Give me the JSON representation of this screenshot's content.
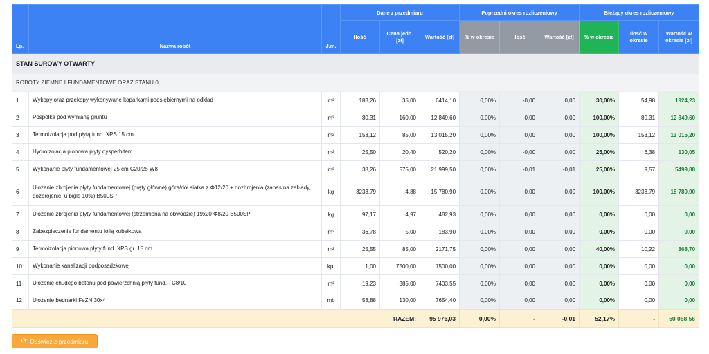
{
  "header": {
    "lp": "Lp.",
    "name": "Nazwa robót",
    "jm": "J.m.",
    "group_przedmiar": "Dane z przedmiaru",
    "group_poprzedni": "Poprzedni okres rozliczeniowy",
    "group_biezacy": "Bieżący okres rozliczeniowy",
    "ilosc": "Ilość",
    "cena": "Cena jedn. [zł]",
    "wartosc": "Wartość [zł]",
    "proc_w_okresie": "% w okresie",
    "ilosc2": "Ilość",
    "wartosc2": "Wartość [zł]",
    "proc_w_okresie3": "% w okresie",
    "ilosc_w_okresie": "Ilość w okresie",
    "wartosc_w_okresie": "Wartość w okresie [zł]"
  },
  "section": "STAN SUROWY OTWARTY",
  "subsection": "ROBOTY ZIEMNE I FUNDAMENTOWE ORAZ STANU 0",
  "rows": [
    {
      "lp": "1",
      "name": "Wykopy oraz przekopy wykonywane koparkami podsiębiernymi na odkład",
      "jm": "m³",
      "ilosc": "183,26",
      "cena": "35,00",
      "wartosc": "6414,10",
      "pp": "0,00%",
      "pi": "-0,00",
      "pw": "0,00",
      "bp": "30,00%",
      "bi": "54,98",
      "bw": "1924,23"
    },
    {
      "lp": "2",
      "name": "Pospółka pod wymianę gruntu",
      "jm": "m³",
      "ilosc": "80,31",
      "cena": "160,00",
      "wartosc": "12 849,60",
      "pp": "0,00%",
      "pi": "0,00",
      "pw": "0,00",
      "bp": "100,00%",
      "bi": "80,31",
      "bw": "12 849,60"
    },
    {
      "lp": "3",
      "name": "Termoizolacja pod płytą fund. XPS 15 cm",
      "jm": "m²",
      "ilosc": "153,12",
      "cena": "85,00",
      "wartosc": "13 015,20",
      "pp": "0,00%",
      "pi": "0,00",
      "pw": "0,00",
      "bp": "100,00%",
      "bi": "153,12",
      "bw": "13 015,20"
    },
    {
      "lp": "4",
      "name": "Hydroizolacja pionowa płyty dysperbitem",
      "jm": "m²",
      "ilosc": "25,50",
      "cena": "20,40",
      "wartosc": "520,20",
      "pp": "0,00%",
      "pi": "-0,00",
      "pw": "0,00",
      "bp": "25,00%",
      "bi": "6,38",
      "bw": "130,05"
    },
    {
      "lp": "5",
      "name": "Wykonanie płyty fundamentowej 25 cm C20/25 W8",
      "jm": "m³",
      "ilosc": "38,26",
      "cena": "575,00",
      "wartosc": "21 999,50",
      "pp": "0,00%",
      "pi": "-0,01",
      "pw": "-0,01",
      "bp": "25,00%",
      "bi": "9,57",
      "bw": "5499,88"
    },
    {
      "lp": "6",
      "name": "Ułożenie zbrojenia płyty fundamentowej (pręty główne) góra/dół siatka z Φ12/20 + dozbrojenia (zapas na zakłady, dozbrojenie, u bigle 10%) B500SP",
      "jm": "kg",
      "ilosc": "3233,79",
      "cena": "4,88",
      "wartosc": "15 780,90",
      "pp": "0,00%",
      "pi": "0,00",
      "pw": "0,00",
      "bp": "100,00%",
      "bi": "3233,79",
      "bw": "15 780,90",
      "tall": true
    },
    {
      "lp": "7",
      "name": "Ułożenie zbrojenia płyty fundamentowej (strzemiona na obwodzie) 19x20 Φ8/20 B500SP",
      "jm": "kg",
      "ilosc": "97,17",
      "cena": "4,97",
      "wartosc": "482,93",
      "pp": "0,00%",
      "pi": "0,00",
      "pw": "0,00",
      "bp": "0,00%",
      "bi": "0,00",
      "bw": "0,00"
    },
    {
      "lp": "8",
      "name": "Zabezpieczenie fundamentu folią kubełkową",
      "jm": "m²",
      "ilosc": "36,78",
      "cena": "5,00",
      "wartosc": "183,90",
      "pp": "0,00%",
      "pi": "0,00",
      "pw": "0,00",
      "bp": "0,00%",
      "bi": "0,00",
      "bw": "0,00"
    },
    {
      "lp": "9",
      "name": "Termoizolacja pionowa płyty fund. XPS gr. 15 cm",
      "jm": "m²",
      "ilosc": "25,55",
      "cena": "85,00",
      "wartosc": "2171,75",
      "pp": "0,00%",
      "pi": "0,00",
      "pw": "0,00",
      "bp": "40,00%",
      "bi": "10,22",
      "bw": "868,70"
    },
    {
      "lp": "10",
      "name": "Wykonanie kanalizacji podposadzkowej",
      "jm": "kpl",
      "ilosc": "1,00",
      "cena": "7500,00",
      "wartosc": "7500,00",
      "pp": "0,00%",
      "pi": "0,00",
      "pw": "0,00",
      "bp": "0,00%",
      "bi": "0,00",
      "bw": "0,00"
    },
    {
      "lp": "11",
      "name": "Ułożenie chudego betonu pod powierzchnią płyty fund. - C8/10",
      "jm": "m³",
      "ilosc": "19,23",
      "cena": "385,00",
      "wartosc": "7403,55",
      "pp": "0,00%",
      "pi": "0,00",
      "pw": "0,00",
      "bp": "0,00%",
      "bi": "0,00",
      "bw": "0,00"
    },
    {
      "lp": "12",
      "name": "Ułożenie bednarki FeZN 30x4",
      "jm": "mb",
      "ilosc": "58,88",
      "cena": "130,00",
      "wartosc": "7654,40",
      "pp": "0,00%",
      "pi": "0,00",
      "pw": "0,00",
      "bp": "0,00%",
      "bi": "0,00",
      "bw": "0,00"
    }
  ],
  "summary": {
    "label": "RAZEM:",
    "wartosc": "95 976,03",
    "pp": "0,00%",
    "pi": "-",
    "pw": "-0,01",
    "bp": "52,17%",
    "bi": "-",
    "bw": "50 068,56"
  },
  "refresh_button": {
    "label": "Odśwież z przedmiaru",
    "icon": "refresh-icon"
  },
  "colors": {
    "header_blue": "#3d82f5",
    "header_gray": "#939aa4",
    "header_green": "#21b358",
    "button_orange": "#f8a83a"
  }
}
